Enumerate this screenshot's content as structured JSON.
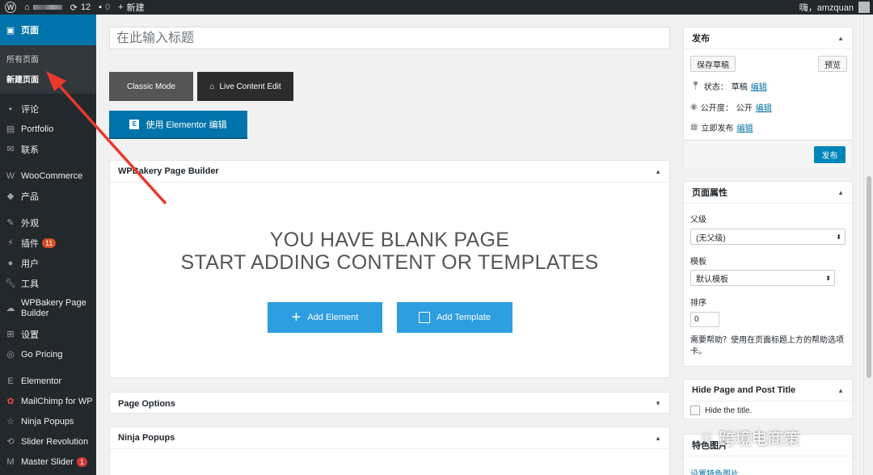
{
  "adminbar": {
    "updates_count": "12",
    "comments_count": "0",
    "new_label": "新建",
    "greeting": "嗨，amzquan"
  },
  "sidebar": {
    "items": [
      {
        "label": "页面",
        "icon": "pages-icon"
      },
      {
        "label": "评论",
        "icon": "comments-icon"
      },
      {
        "label": "Portfolio",
        "icon": "portfolio-icon"
      },
      {
        "label": "联系",
        "icon": "mail-icon"
      },
      {
        "label": "WooCommerce",
        "icon": "woocommerce-icon"
      },
      {
        "label": "产品",
        "icon": "products-icon"
      },
      {
        "label": "外观",
        "icon": "appearance-icon"
      },
      {
        "label": "插件",
        "icon": "plugins-icon",
        "badge": "11"
      },
      {
        "label": "用户",
        "icon": "users-icon"
      },
      {
        "label": "工具",
        "icon": "tools-icon"
      },
      {
        "label": "WPBakery Page Builder",
        "icon": "wpbakery-icon"
      },
      {
        "label": "设置",
        "icon": "settings-icon"
      },
      {
        "label": "Go Pricing",
        "icon": "go-pricing-icon"
      },
      {
        "label": "Elementor",
        "icon": "elementor-icon"
      },
      {
        "label": "MailChimp for WP",
        "icon": "mailchimp-icon"
      },
      {
        "label": "Ninja Popups",
        "icon": "star-icon"
      },
      {
        "label": "Slider Revolution",
        "icon": "revolution-icon"
      },
      {
        "label": "Master Slider",
        "icon": "master-slider-icon",
        "badge": "1"
      }
    ],
    "submenu": [
      "所有页面",
      "新建页面"
    ]
  },
  "editor": {
    "title_placeholder": "在此输入标题",
    "classic_mode": "Classic Mode",
    "live_content_edit": "Live Content Edit",
    "elementor_edit": "使用 Elementor 编辑"
  },
  "wpbakery": {
    "title": "WPBakery Page Builder",
    "blank_line1": "YOU HAVE BLANK PAGE",
    "blank_line2": "START ADDING CONTENT OR TEMPLATES",
    "add_element": "Add Element",
    "add_template": "Add Template"
  },
  "page_options": {
    "title": "Page Options"
  },
  "ninja_popups": {
    "title": "Ninja Popups"
  },
  "publish": {
    "title": "发布",
    "save_draft": "保存草稿",
    "preview": "预览",
    "status_label": "状态：",
    "status_value": "草稿",
    "visibility_label": "公开度：",
    "visibility_value": "公开",
    "schedule_label": "立即发布",
    "edit": "编辑",
    "publish_button": "发布"
  },
  "page_attributes": {
    "title": "页面属性",
    "parent_label": "父级",
    "parent_value": "(无父级)",
    "template_label": "模板",
    "template_value": "默认模板",
    "order_label": "排序",
    "order_value": "0",
    "help_text": "需要帮助？使用在页面标题上方的帮助选项卡。"
  },
  "hide_title": {
    "title": "Hide Page and Post Title",
    "checkbox_label": "Hide the title."
  },
  "featured_image": {
    "title": "特色图片",
    "set_link": "设置特色图片"
  },
  "watermark": {
    "text": "跨境电商策"
  },
  "colors": {
    "sidebar_bg": "#23282d",
    "active_menu": "#0073aa",
    "wpbakery_button": "#2d9ee0",
    "annotation_arrow": "#e8392b"
  }
}
